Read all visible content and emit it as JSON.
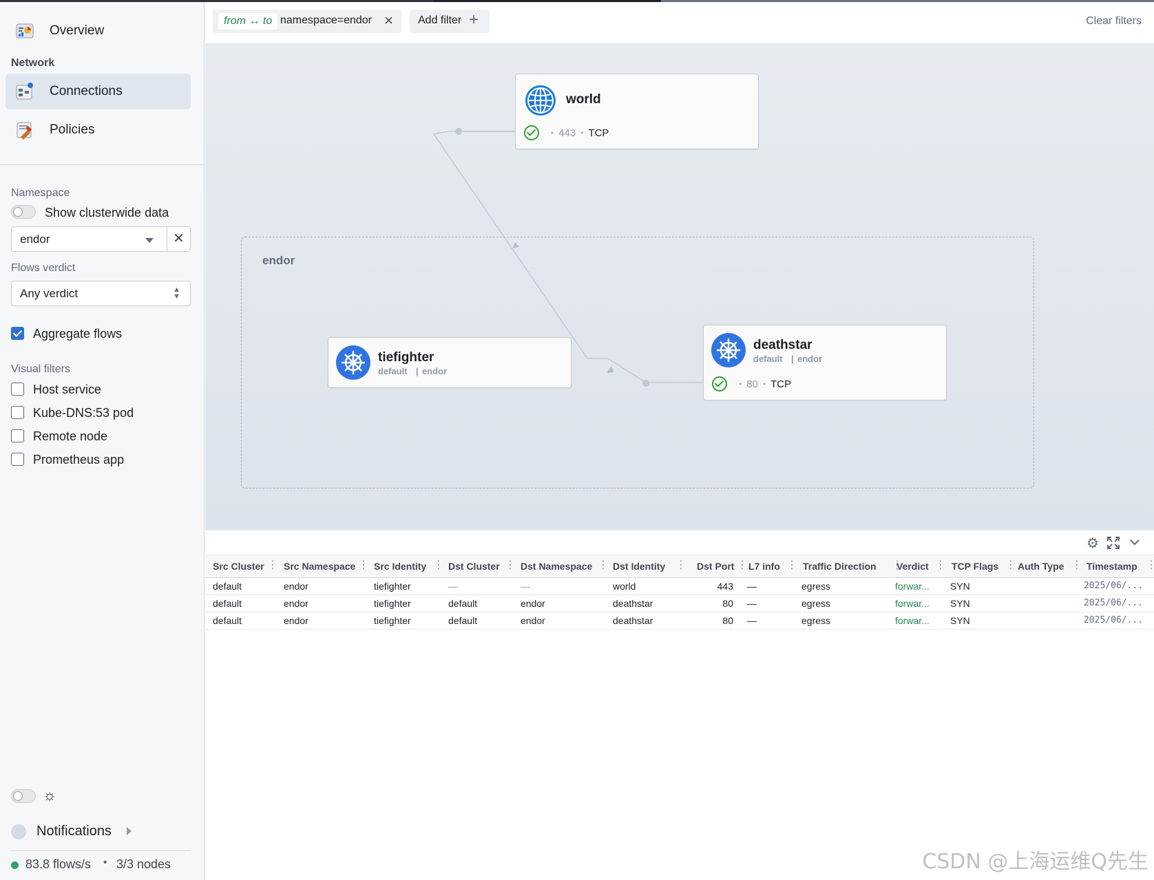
{
  "sidebar": {
    "overview_label": "Overview",
    "network_section": "Network",
    "connections_label": "Connections",
    "policies_label": "Policies",
    "namespace_section": "Namespace",
    "show_clusterwide_label": "Show clusterwide data",
    "show_clusterwide_on": false,
    "namespace_value": "endor",
    "verdict_section": "Flows verdict",
    "verdict_value": "Any verdict",
    "aggregate_label": "Aggregate flows",
    "aggregate_checked": true,
    "visual_filters_section": "Visual filters",
    "visual_filters": [
      {
        "label": "Host service",
        "checked": false
      },
      {
        "label": "Kube-DNS:53 pod",
        "checked": false
      },
      {
        "label": "Remote node",
        "checked": false
      },
      {
        "label": "Prometheus app",
        "checked": false
      }
    ],
    "theme_toggle_on": false,
    "notifications_label": "Notifications",
    "flows_rate": "83.8 flows/s",
    "nodes": "3/3 nodes"
  },
  "filterbar": {
    "chip_direction": "from ↔ to",
    "chip_value": "namespace=endor",
    "add_filter_label": "Add filter",
    "clear_filters_label": "Clear filters"
  },
  "map": {
    "namespace_box_label": "endor",
    "world": {
      "title": "world",
      "port": "443",
      "protocol": "TCP"
    },
    "tiefighter": {
      "title": "tiefighter",
      "cluster": "default",
      "namespace": "endor"
    },
    "deathstar": {
      "title": "deathstar",
      "cluster": "default",
      "namespace": "endor",
      "port": "80",
      "protocol": "TCP"
    }
  },
  "table": {
    "columns": [
      "Src Cluster",
      "Src Namespace",
      "Src Identity",
      "Dst Cluster",
      "Dst Namespace",
      "Dst Identity",
      "Dst Port",
      "L7 info",
      "Traffic Direction",
      "Verdict",
      "TCP Flags",
      "Auth Type",
      "Timestamp"
    ],
    "rows": [
      [
        "default",
        "endor",
        "tiefighter",
        "—",
        "—",
        "world",
        "443",
        "—",
        "egress",
        "forwar...",
        "SYN",
        "",
        "2025/06/..."
      ],
      [
        "default",
        "endor",
        "tiefighter",
        "default",
        "endor",
        "deathstar",
        "80",
        "—",
        "egress",
        "forwar...",
        "SYN",
        "",
        "2025/06/..."
      ],
      [
        "default",
        "endor",
        "tiefighter",
        "default",
        "endor",
        "deathstar",
        "80",
        "—",
        "egress",
        "forwar...",
        "SYN",
        "",
        "2025/06/..."
      ]
    ]
  },
  "watermark": "CSDN @上海运维Q先生",
  "colors": {
    "accent": "#2d72d2",
    "verdict_forwarded": "#238551",
    "status_ok": "#29a329",
    "kube_blue": "#2f74e0"
  },
  "icons": [
    "overview-icon",
    "connections-icon",
    "policies-icon",
    "globe-icon",
    "kubernetes-helm-icon",
    "check-circle-icon",
    "gear-icon",
    "expand-icon",
    "chevron-down-icon",
    "sun-icon",
    "bell-icon",
    "plus-icon",
    "close-icon"
  ]
}
